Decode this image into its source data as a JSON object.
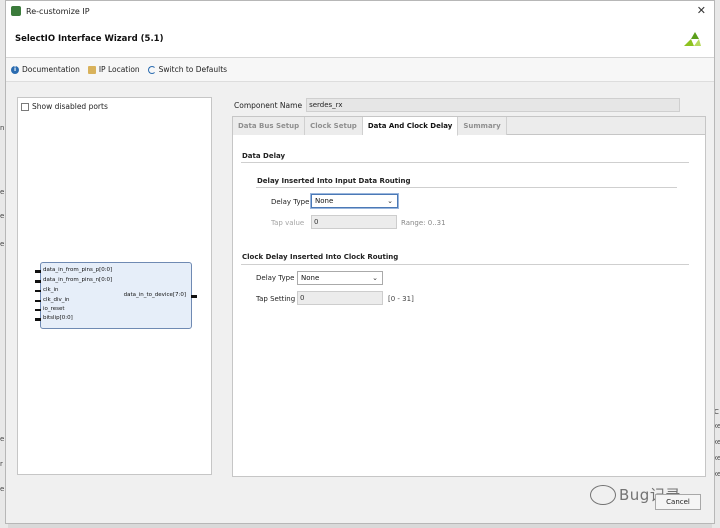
{
  "window": {
    "title": "Re-customize IP",
    "close_glyph": "✕"
  },
  "header": {
    "title": "SelectIO Interface Wizard (5.1)"
  },
  "toolbar": {
    "documentation": "Documentation",
    "ip_location": "IP Location",
    "switch_defaults": "Switch to Defaults"
  },
  "left": {
    "show_disabled_ports": "Show disabled ports",
    "block": {
      "inputs": [
        "data_in_from_pins_p[0:0]",
        "data_in_from_pins_n[0:0]",
        "clk_in",
        "clk_div_in",
        "io_reset",
        "bitslip[0:0]"
      ],
      "output": "data_in_to_device[7:0]"
    }
  },
  "component": {
    "label": "Component Name",
    "value": "serdes_rx"
  },
  "tabs": [
    {
      "label": "Data Bus Setup"
    },
    {
      "label": "Clock Setup"
    },
    {
      "label": "Data And Clock Delay"
    },
    {
      "label": "Summary"
    }
  ],
  "active_tab": "Data And Clock Delay",
  "data_delay": {
    "title": "Data Delay",
    "subsection_title": "Delay Inserted Into Input Data Routing",
    "delay_type_label": "Delay Type",
    "delay_type_value": "None",
    "tap_value_label": "Tap value",
    "tap_value": "0",
    "range_hint": "Range: 0..31"
  },
  "clock_delay": {
    "title": "Clock Delay Inserted Into Clock Routing",
    "delay_type_label": "Delay Type",
    "delay_type_value": "None",
    "tap_setting_label": "Tap Setting",
    "tap_setting_value": "0",
    "range_hint": "[0 - 31]"
  },
  "footer": {
    "cancel": "Cancel",
    "watermark": "Bug记录"
  },
  "background_fragments": [
    "n",
    "e",
    "e",
    "e",
    "e",
    "r",
    "e",
    "C",
    "xe",
    "xe",
    "xe",
    "xe"
  ],
  "colors": {
    "accent": "#4b79b6",
    "block_fill": "#e6eef9",
    "logo": "#8dc21f"
  }
}
